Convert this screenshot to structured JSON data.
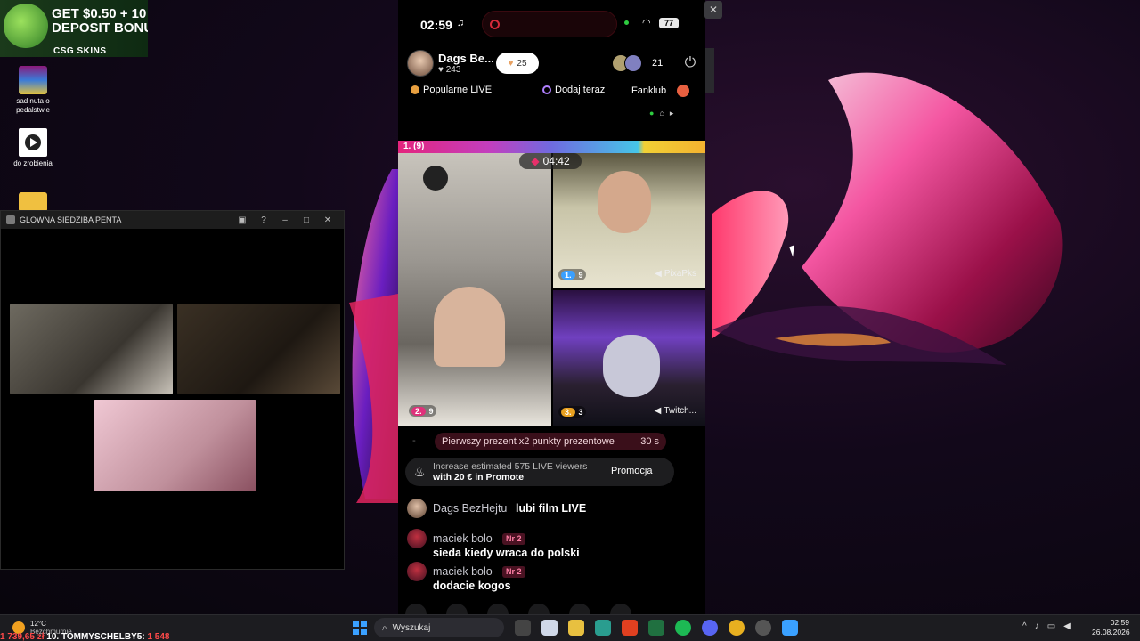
{
  "desktop": {
    "ad": {
      "text": "GET $0.50 + 10\nDEPOSIT BONU",
      "logo": "CSG SKINS"
    },
    "icons": [
      {
        "label": "sad nuta o pedalstwie",
        "icon": "winrar-icon"
      },
      {
        "label": "do zrobienia",
        "icon": "video-file-icon"
      },
      {
        "label": "",
        "icon": "folder-icon"
      }
    ]
  },
  "left_window": {
    "title": "GLOWNA SIEDZIBA PENTA",
    "controls": [
      "minimize",
      "maximize",
      "close"
    ]
  },
  "phone": {
    "status": {
      "time": "02:59",
      "battery": "77"
    },
    "host": {
      "name": "Dags Be...",
      "likes": "243",
      "fans": "25"
    },
    "viewer_count": "21",
    "nav": {
      "popular": "Popularne LIVE",
      "add": "Dodaj teraz",
      "fanclub": "Fanklub"
    },
    "battle": {
      "label": "1. (9)",
      "timer": "04:42"
    },
    "tiles": [
      {
        "rank": "2.",
        "score": "9",
        "name": ""
      },
      {
        "rank": "1.",
        "score": "9",
        "name": "PixaPks"
      },
      {
        "rank": "3.",
        "score": "3",
        "name": "Twitch..."
      }
    ],
    "gift_banner": {
      "text": "Pierwszy prezent x2 punkty prezentowe",
      "time": "30 s"
    },
    "promo": {
      "line1": "Increase estimated 575 LIVE viewers",
      "line2": "with 20 € in Promote",
      "button": "Promocja"
    },
    "chat": [
      {
        "user": "Dags BezHejtu",
        "message": "lubi film LIVE",
        "badge": ""
      },
      {
        "user": "maciek bolo",
        "message": "sieda kiedy wraca do polski",
        "badge": "Nr 2"
      },
      {
        "user": "maciek bolo",
        "message": "dodacie kogos",
        "badge": "Nr 2"
      }
    ]
  },
  "taskbar": {
    "weather": {
      "temp": "12°C",
      "desc": "Bezchmurnie"
    },
    "ticker": {
      "amount": "1 739,65 zł",
      "rank_text": "10. TOMMYSCHELBY5:",
      "value": "1 548"
    },
    "search_placeholder": "Wyszukaj",
    "clock": {
      "time": "02:59",
      "date": "26.08.2026"
    },
    "colors": {
      "accent": "#3aa0ff"
    }
  }
}
